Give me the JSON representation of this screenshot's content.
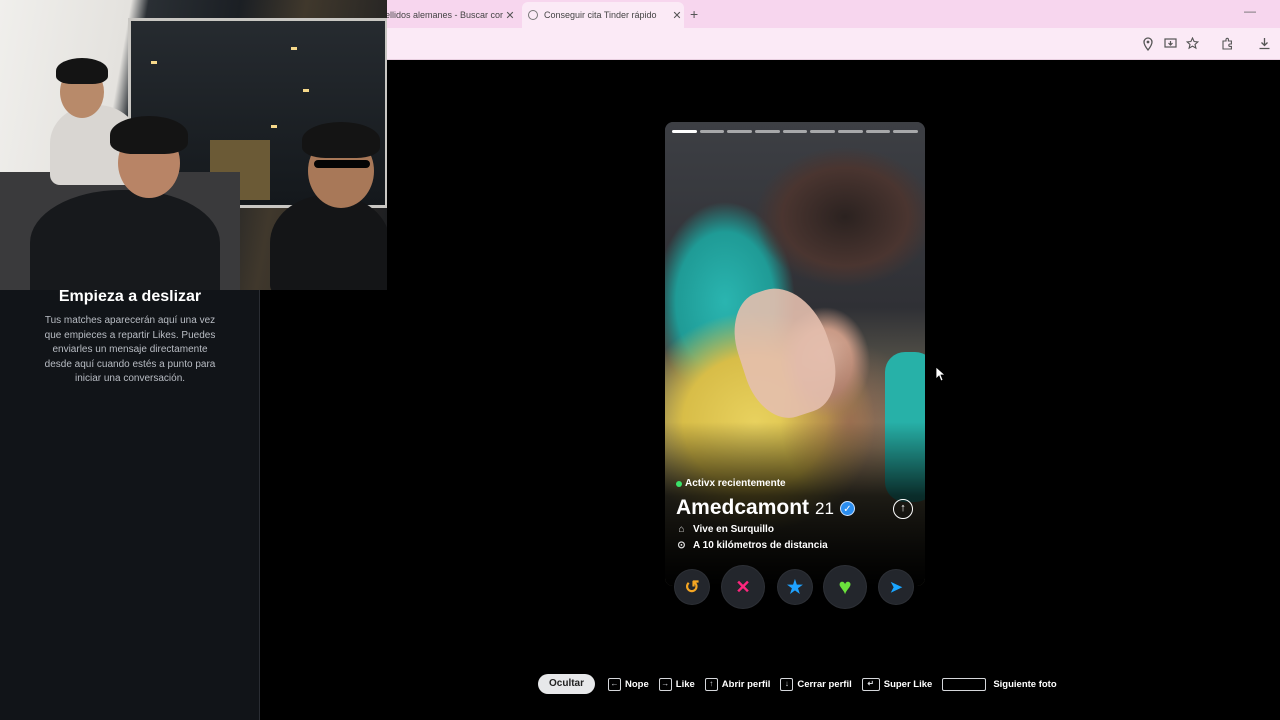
{
  "browser": {
    "tabs": [
      {
        "title": "ellidos alemanes - Buscar cor",
        "close": "✕"
      },
      {
        "title": "Conseguir cita Tinder rápido",
        "close": "✕"
      }
    ],
    "new_tab": "+",
    "minimize": "—"
  },
  "sidebar": {
    "empty_title": "Empieza a deslizar",
    "empty_description": "Tus matches aparecerán aquí una vez que empieces a repartir Likes. Puedes enviarles un mensaje directamente desde aquí cuando estés a punto para iniciar una conversación."
  },
  "profile": {
    "photo_count": 9,
    "active_photo": 1,
    "status": "Activx recientemente",
    "name": "Amedcamont",
    "age": "21",
    "verified": true,
    "lives_in": "Vive en Surquillo",
    "distance": "A 10 kilómetros de distancia"
  },
  "actions": [
    {
      "name": "rewind",
      "glyph": "↺",
      "color": "#f5a623"
    },
    {
      "name": "nope",
      "glyph": "✕",
      "color": "#fd267d"
    },
    {
      "name": "super-like",
      "glyph": "★",
      "color": "#1fa2ff"
    },
    {
      "name": "like",
      "glyph": "♥",
      "color": "#6be33c"
    },
    {
      "name": "boost",
      "glyph": "➤",
      "color": "#1aa5ff"
    }
  ],
  "shortcuts": {
    "hide": "Ocultar",
    "nope": "Nope",
    "like": "Like",
    "open_profile": "Abrir perfil",
    "close_profile": "Cerrar perfil",
    "super_like": "Super Like",
    "next_photo": "Siguiente foto"
  }
}
